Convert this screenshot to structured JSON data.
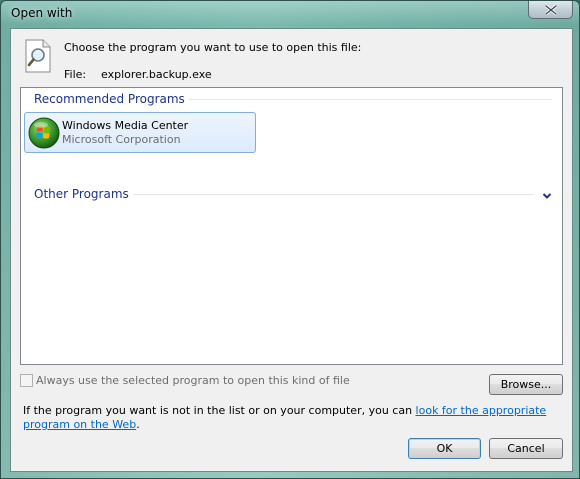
{
  "window": {
    "title": "Open with",
    "close_icon": "close-icon"
  },
  "header": {
    "prompt": "Choose the program you want to use to open this file:",
    "file_label": "File:",
    "file_name": "explorer.backup.exe",
    "icon": "file-magnifier-icon"
  },
  "program_list": {
    "recommended_header": "Recommended Programs",
    "other_header": "Other Programs",
    "expand_icon": "chevron-down-icon",
    "recommended": [
      {
        "name": "Windows Media Center",
        "publisher": "Microsoft Corporation",
        "icon": "windows-media-center-icon"
      }
    ]
  },
  "options": {
    "always_use_label": "Always use the selected program to open this kind of file",
    "always_use_checked": false,
    "always_use_enabled": false
  },
  "buttons": {
    "browse": "Browse...",
    "ok": "OK",
    "cancel": "Cancel"
  },
  "help": {
    "text_before": "If the program you want is not in the list or on your computer, you can ",
    "link": "look for the appropriate program on the Web",
    "text_after": "."
  },
  "colors": {
    "group_header": "#1e3287",
    "link": "#0066cc",
    "selection_border": "#84acdd"
  }
}
